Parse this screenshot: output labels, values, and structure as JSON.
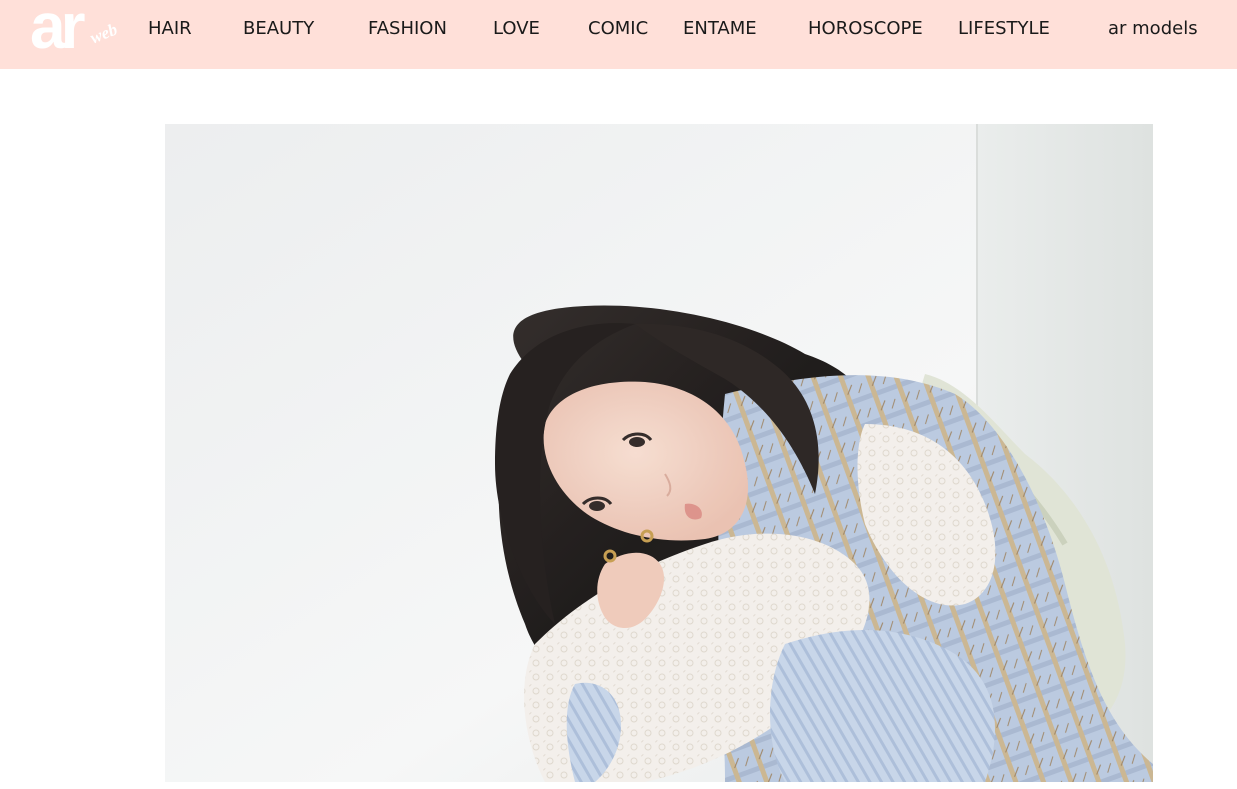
{
  "header": {
    "logo": {
      "main": "ar",
      "sub": "web"
    },
    "nav": [
      {
        "label": "HAIR"
      },
      {
        "label": "BEAUTY"
      },
      {
        "label": "FASHION"
      },
      {
        "label": "LOVE"
      },
      {
        "label": "COMIC"
      },
      {
        "label": "ENTAME"
      },
      {
        "label": "HOROSCOPE"
      },
      {
        "label": "LIFESTYLE"
      },
      {
        "label": "ar models"
      }
    ]
  },
  "main": {
    "hero_image": {
      "subject": "model-portrait-photo"
    }
  },
  "colors": {
    "header_bg": "#ffe0d9",
    "nav_text": "#1a1a1a",
    "logo": "#ffffff"
  }
}
